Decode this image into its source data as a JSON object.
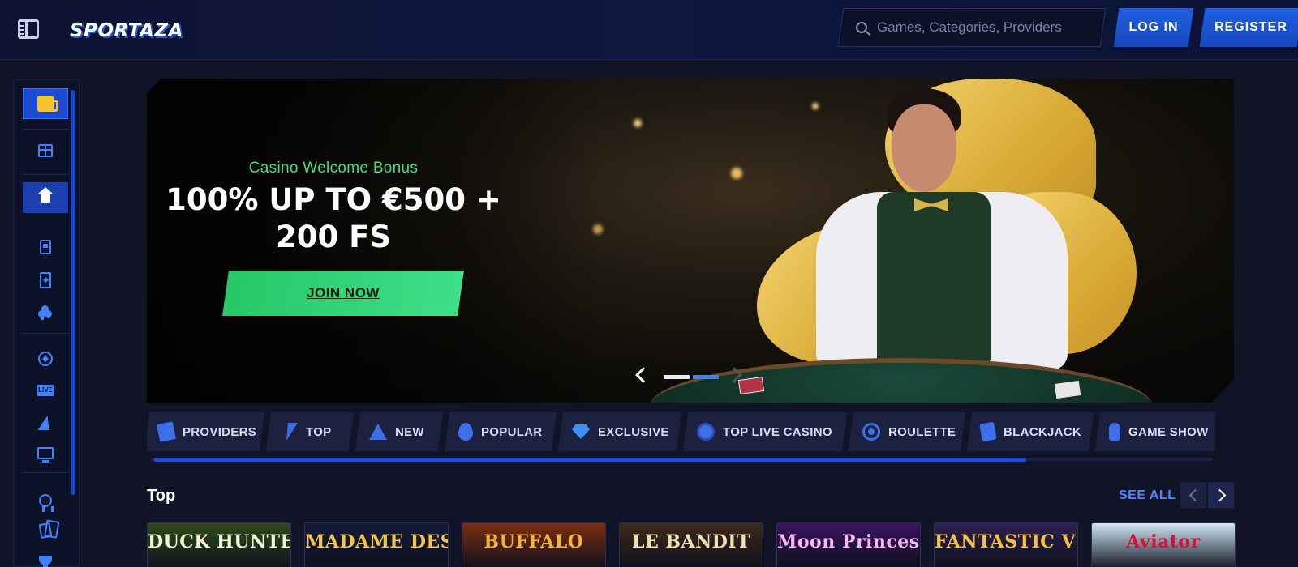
{
  "header": {
    "logo_text": "SPORTAZA",
    "search_placeholder": "Games, Categories, Providers",
    "login_label": "LOG IN",
    "register_label": "REGISTER"
  },
  "sidebar": {
    "items": [
      {
        "icon": "beer-icon"
      },
      {
        "icon": "gift-icon"
      },
      {
        "icon": "home-icon"
      },
      {
        "icon": "slot-machine-icon"
      },
      {
        "icon": "card-icon"
      },
      {
        "icon": "clover-icon"
      },
      {
        "icon": "football-icon"
      },
      {
        "icon": "live-icon",
        "label": "LIVE"
      },
      {
        "icon": "horse-racing-icon"
      },
      {
        "icon": "virtual-sports-icon"
      },
      {
        "icon": "badge-icon"
      },
      {
        "icon": "cards-icon"
      },
      {
        "icon": "trophy-icon"
      }
    ]
  },
  "banner": {
    "subtitle": "Casino Welcome Bonus",
    "title_line1": "100% UP TO €500 +",
    "title_line2": "200 FS",
    "cta_label": "JOIN NOW",
    "slide_count": 2,
    "active_slide": 2
  },
  "categories": [
    {
      "label": "PROVIDERS",
      "icon": "book-icon"
    },
    {
      "label": "TOP",
      "icon": "lightning-icon"
    },
    {
      "label": "NEW",
      "icon": "star-icon"
    },
    {
      "label": "POPULAR",
      "icon": "flame-icon"
    },
    {
      "label": "EXCLUSIVE",
      "icon": "diamond-icon"
    },
    {
      "label": "TOP LIVE CASINO",
      "icon": "chip-icon"
    },
    {
      "label": "ROULETTE",
      "icon": "roulette-icon"
    },
    {
      "label": "BLACKJACK",
      "icon": "dice-icon"
    },
    {
      "label": "GAME SHOW",
      "icon": "microphone-icon"
    }
  ],
  "section": {
    "title": "Top",
    "see_all_label": "SEE ALL"
  },
  "games": [
    {
      "title": "DUCK HUNTERS",
      "bg": "#2d4a1c",
      "color": "#f2f5d0"
    },
    {
      "title": "MADAME DESTINY",
      "bg": "#161a3a",
      "color": "#f0c74a"
    },
    {
      "title": "BUFFALO",
      "bg": "#7a2e12",
      "color": "#f7b23b"
    },
    {
      "title": "LE BANDIT",
      "bg": "#3c2a1a",
      "color": "#f3e0b0"
    },
    {
      "title": "Moon Princess",
      "bg": "#3a1460",
      "color": "#f7b8ef"
    },
    {
      "title": "FANTASTIC VIKINGS",
      "bg": "#2d2150",
      "color": "#f4c23e"
    },
    {
      "title": "Aviator",
      "bg": "#cfe7f5",
      "color": "#d4113a"
    }
  ],
  "colors": {
    "accent": "#1f5fe0",
    "cta": "#2ecf72",
    "bg": "#111427"
  }
}
